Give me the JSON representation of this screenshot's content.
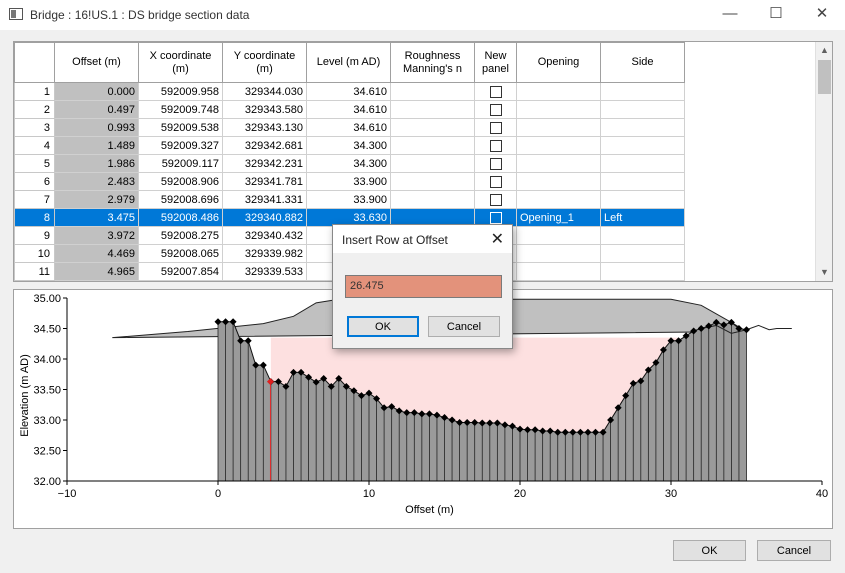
{
  "window": {
    "title": "Bridge : 16!US.1 : DS bridge section data",
    "minimize": "—",
    "maximize": "☐",
    "close": "✕"
  },
  "grid": {
    "headers": [
      "",
      "Offset (m)",
      "X coordinate\n(m)",
      "Y coordinate\n(m)",
      "Level (m AD)",
      "Roughness\nManning's n",
      "New\npanel",
      "Opening",
      "Side"
    ],
    "rows": [
      {
        "n": "1",
        "offset": "0.000",
        "x": "592009.958",
        "y": "329344.030",
        "level": "34.610",
        "opening": "",
        "side": ""
      },
      {
        "n": "2",
        "offset": "0.497",
        "x": "592009.748",
        "y": "329343.580",
        "level": "34.610",
        "opening": "",
        "side": ""
      },
      {
        "n": "3",
        "offset": "0.993",
        "x": "592009.538",
        "y": "329343.130",
        "level": "34.610",
        "opening": "",
        "side": ""
      },
      {
        "n": "4",
        "offset": "1.489",
        "x": "592009.327",
        "y": "329342.681",
        "level": "34.300",
        "opening": "",
        "side": ""
      },
      {
        "n": "5",
        "offset": "1.986",
        "x": "592009.117",
        "y": "329342.231",
        "level": "34.300",
        "opening": "",
        "side": ""
      },
      {
        "n": "6",
        "offset": "2.483",
        "x": "592008.906",
        "y": "329341.781",
        "level": "33.900",
        "opening": "",
        "side": ""
      },
      {
        "n": "7",
        "offset": "2.979",
        "x": "592008.696",
        "y": "329341.331",
        "level": "33.900",
        "opening": "",
        "side": ""
      },
      {
        "n": "8",
        "offset": "3.475",
        "x": "592008.486",
        "y": "329340.882",
        "level": "33.630",
        "opening": "Opening_1",
        "side": "Left",
        "selected": true
      },
      {
        "n": "9",
        "offset": "3.972",
        "x": "592008.275",
        "y": "329340.432",
        "level": "",
        "opening": "",
        "side": ""
      },
      {
        "n": "10",
        "offset": "4.469",
        "x": "592008.065",
        "y": "329339.982",
        "level": "",
        "opening": "",
        "side": ""
      },
      {
        "n": "11",
        "offset": "4.965",
        "x": "592007.854",
        "y": "329339.533",
        "level": "",
        "opening": "",
        "side": ""
      }
    ]
  },
  "chart_data": {
    "type": "area",
    "xlabel": "Offset (m)",
    "ylabel": "Elevation (m AD)",
    "xlim": [
      -10,
      40
    ],
    "ylim": [
      32.0,
      35.0
    ],
    "xticks": [
      "−10",
      "0",
      "10",
      "20",
      "30",
      "40"
    ],
    "yticks": [
      "32.00",
      "32.50",
      "33.00",
      "33.50",
      "34.00",
      "34.50",
      "35.00"
    ],
    "section": [
      [
        0.0,
        34.61
      ],
      [
        0.5,
        34.61
      ],
      [
        1.0,
        34.61
      ],
      [
        1.5,
        34.3
      ],
      [
        2.0,
        34.3
      ],
      [
        2.5,
        33.9
      ],
      [
        3.0,
        33.9
      ],
      [
        3.5,
        33.63
      ],
      [
        4.0,
        33.63
      ],
      [
        4.5,
        33.55
      ],
      [
        5.0,
        33.78
      ],
      [
        5.5,
        33.78
      ],
      [
        6.0,
        33.7
      ],
      [
        6.5,
        33.62
      ],
      [
        7.0,
        33.68
      ],
      [
        7.5,
        33.55
      ],
      [
        8.0,
        33.68
      ],
      [
        8.5,
        33.55
      ],
      [
        9.0,
        33.48
      ],
      [
        9.5,
        33.4
      ],
      [
        10.0,
        33.44
      ],
      [
        10.5,
        33.35
      ],
      [
        11.0,
        33.2
      ],
      [
        11.5,
        33.22
      ],
      [
        12.0,
        33.15
      ],
      [
        12.5,
        33.12
      ],
      [
        13.0,
        33.12
      ],
      [
        13.5,
        33.1
      ],
      [
        14.0,
        33.1
      ],
      [
        14.5,
        33.08
      ],
      [
        15.0,
        33.04
      ],
      [
        15.5,
        33.0
      ],
      [
        16.0,
        32.96
      ],
      [
        16.5,
        32.96
      ],
      [
        17.0,
        32.96
      ],
      [
        17.5,
        32.95
      ],
      [
        18.0,
        32.95
      ],
      [
        18.5,
        32.95
      ],
      [
        19.0,
        32.92
      ],
      [
        19.5,
        32.9
      ],
      [
        20.0,
        32.85
      ],
      [
        20.5,
        32.84
      ],
      [
        21.0,
        32.84
      ],
      [
        21.5,
        32.82
      ],
      [
        22.0,
        32.82
      ],
      [
        22.5,
        32.8
      ],
      [
        23.0,
        32.8
      ],
      [
        23.5,
        32.8
      ],
      [
        24.0,
        32.8
      ],
      [
        24.5,
        32.8
      ],
      [
        25.0,
        32.8
      ],
      [
        25.5,
        32.8
      ],
      [
        26.0,
        33.0
      ],
      [
        26.5,
        33.2
      ],
      [
        27.0,
        33.4
      ],
      [
        27.5,
        33.6
      ],
      [
        28.0,
        33.64
      ],
      [
        28.5,
        33.82
      ],
      [
        29.0,
        33.94
      ],
      [
        29.5,
        34.15
      ],
      [
        30.0,
        34.3
      ],
      [
        30.5,
        34.3
      ],
      [
        31.0,
        34.38
      ],
      [
        31.5,
        34.46
      ],
      [
        32.0,
        34.5
      ],
      [
        32.5,
        34.54
      ],
      [
        33.0,
        34.6
      ],
      [
        33.5,
        34.56
      ],
      [
        34.0,
        34.6
      ],
      [
        34.5,
        34.5
      ],
      [
        35.0,
        34.48
      ]
    ],
    "deck_top": [
      [
        -7,
        34.35
      ],
      [
        -2,
        34.45
      ],
      [
        3,
        34.58
      ],
      [
        5,
        34.7
      ],
      [
        6.5,
        34.92
      ],
      [
        8,
        34.98
      ],
      [
        30,
        34.98
      ],
      [
        32,
        34.88
      ],
      [
        34,
        34.6
      ],
      [
        35,
        34.45
      ],
      [
        -7,
        34.35
      ]
    ],
    "soffit_level": 34.35,
    "opening_range": [
      3.5,
      30.5
    ],
    "bank_profile": [
      [
        32,
        34.5
      ],
      [
        33,
        34.55
      ],
      [
        34,
        34.42
      ],
      [
        35,
        34.48
      ],
      [
        35.8,
        34.55
      ],
      [
        36.5,
        34.48
      ],
      [
        37,
        34.5
      ],
      [
        38,
        34.5
      ]
    ],
    "selected_point": [
      3.475,
      33.63
    ]
  },
  "dialog": {
    "title": "Insert Row at Offset",
    "close": "✕",
    "value": "26.475",
    "ok": "OK",
    "cancel": "Cancel"
  },
  "footer": {
    "ok": "OK",
    "cancel": "Cancel"
  },
  "colors": {
    "selection": "#0078d7",
    "deck": "#c0c0c0",
    "opening_fill": "#fde0e0",
    "input_bg": "#e3927b"
  }
}
